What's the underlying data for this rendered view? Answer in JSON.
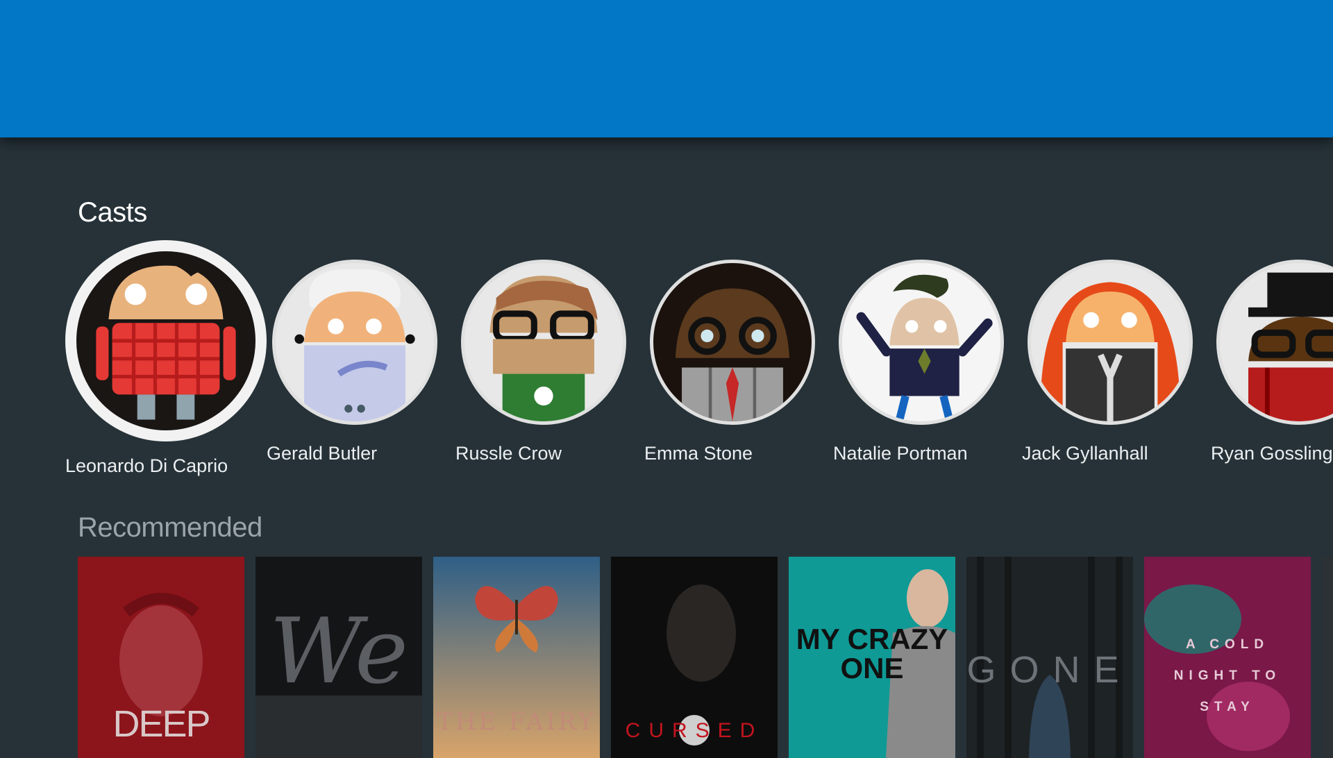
{
  "header": {
    "color": "#0277C6"
  },
  "sections": {
    "casts_title": "Casts",
    "recommended_title": "Recommended"
  },
  "casts": [
    {
      "name": "Leonardo Di Caprio",
      "icon": "android-avatar-plaid-shirt-icon"
    },
    {
      "name": "Gerald Butler",
      "icon": "android-avatar-grey-hair-icon"
    },
    {
      "name": "Russle Crow",
      "icon": "android-avatar-glasses-jersey-icon"
    },
    {
      "name": "Emma Stone",
      "icon": "android-avatar-round-glasses-suit-icon"
    },
    {
      "name": "Natalie Portman",
      "icon": "android-avatar-arms-up-icon"
    },
    {
      "name": "Jack Gyllanhall",
      "icon": "android-avatar-red-hair-icon"
    },
    {
      "name": "Ryan Gossling",
      "icon": "android-avatar-top-hat-icon"
    }
  ],
  "recommended": [
    {
      "title": "DEEP",
      "bg": "#8c141b"
    },
    {
      "title": "We",
      "bg": "#141516"
    },
    {
      "title": "THE FAIRY",
      "bg": "#3d6b8a"
    },
    {
      "title": "CURSED",
      "bg": "#0d0d0d"
    },
    {
      "title": "MY CRAZY ONE",
      "bg": "#0f9a96"
    },
    {
      "title": "GONE",
      "bg": "#1e2326"
    },
    {
      "title": "A COLD NIGHT TO STAY",
      "bg": "#7a1848"
    }
  ],
  "colors": {
    "background": "#263238",
    "accent": "#0277C6",
    "selected_ring": "#f2f2f2"
  }
}
